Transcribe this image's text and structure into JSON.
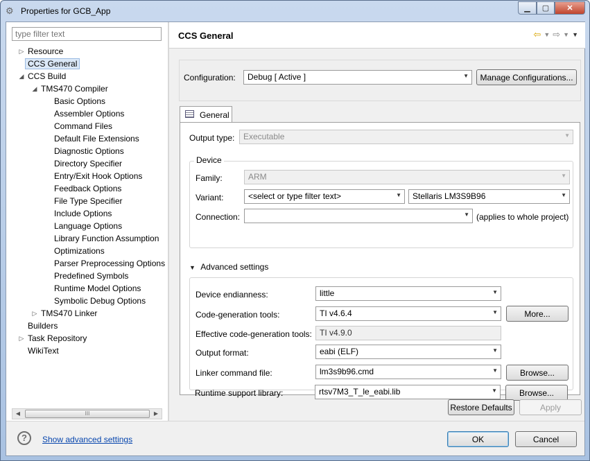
{
  "window": {
    "title": "Properties for GCB_App"
  },
  "sidebar": {
    "filter_placeholder": "type filter text",
    "tree": [
      {
        "label": "Resource"
      },
      {
        "label": "CCS General"
      },
      {
        "label": "CCS Build"
      },
      {
        "label": "TMS470 Compiler"
      },
      {
        "label": "Basic Options"
      },
      {
        "label": "Assembler Options"
      },
      {
        "label": "Command Files"
      },
      {
        "label": "Default File Extensions"
      },
      {
        "label": "Diagnostic Options"
      },
      {
        "label": "Directory Specifier"
      },
      {
        "label": "Entry/Exit Hook Options"
      },
      {
        "label": "Feedback Options"
      },
      {
        "label": "File Type Specifier"
      },
      {
        "label": "Include Options"
      },
      {
        "label": "Language Options"
      },
      {
        "label": "Library Function Assumption"
      },
      {
        "label": "Optimizations"
      },
      {
        "label": "Parser Preprocessing Options"
      },
      {
        "label": "Predefined Symbols"
      },
      {
        "label": "Runtime Model Options"
      },
      {
        "label": "Symbolic Debug Options"
      },
      {
        "label": "TMS470 Linker"
      },
      {
        "label": "Builders"
      },
      {
        "label": "Task Repository"
      },
      {
        "label": "WikiText"
      }
    ],
    "scroll_thumb": "III"
  },
  "header": {
    "title": "CCS General"
  },
  "config": {
    "label": "Configuration:",
    "value": "Debug  [ Active ]",
    "manage_button": "Manage Configurations..."
  },
  "tab": {
    "label": "General"
  },
  "general": {
    "output_type_label": "Output type:",
    "output_type_value": "Executable",
    "device_group_title": "Device",
    "family_label": "Family:",
    "family_value": "ARM",
    "variant_label": "Variant:",
    "variant_filter_value": "<select or type filter text>",
    "variant_value": "Stellaris LM3S9B96",
    "connection_label": "Connection:",
    "connection_value": "",
    "connection_note": "(applies to whole project)",
    "advanced_title": "Advanced settings",
    "endianness_label": "Device endianness:",
    "endianness_value": "little",
    "codegen_label": "Code-generation tools:",
    "codegen_value": "TI v4.6.4",
    "more_button": "More...",
    "effective_label": "Effective code-generation tools:",
    "effective_value": "TI v4.9.0",
    "output_format_label": "Output format:",
    "output_format_value": "eabi (ELF)",
    "linker_label": "Linker command file:",
    "linker_value": "lm3s9b96.cmd",
    "browse_button": "Browse...",
    "runtime_label": "Runtime support library:",
    "runtime_value": "rtsv7M3_T_le_eabi.lib"
  },
  "actions": {
    "restore_defaults": "Restore Defaults",
    "apply": "Apply",
    "ok": "OK",
    "cancel": "Cancel",
    "show_advanced": "Show advanced settings",
    "help": "?"
  }
}
